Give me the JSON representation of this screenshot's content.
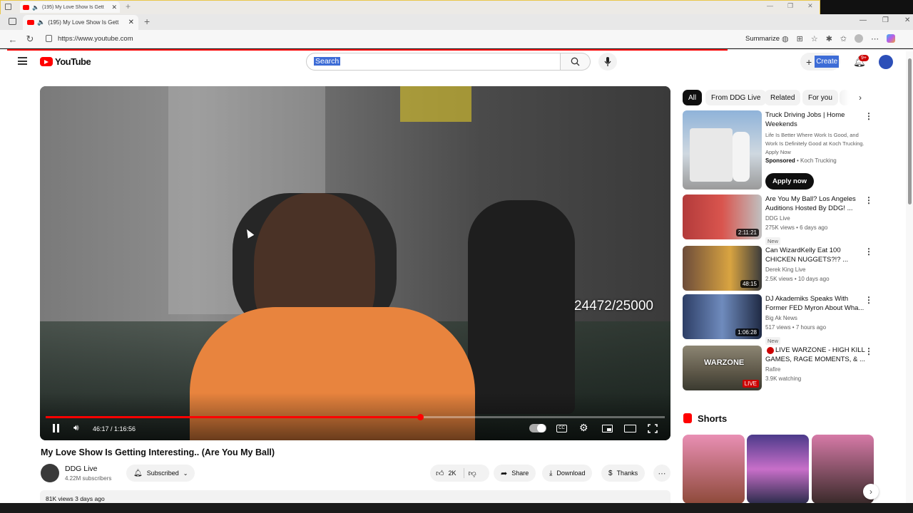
{
  "outer_tab": {
    "title": "(195) My Love Show Is Gett"
  },
  "browser": {
    "tab_title": "(195) My Love Show Is Gett",
    "url": "https://www.youtube.com",
    "summarize": "Summarize"
  },
  "header": {
    "logo_text": "YouTube",
    "search_value": "Search",
    "create_label": "Create",
    "notif_count": "9+"
  },
  "player": {
    "overlay_counter": "24472/25000",
    "time": "46:17 / 1:16:56",
    "progress": 0.605
  },
  "video": {
    "title": "My Love Show Is Getting Interesting.. (Are You My Ball)",
    "channel": "DDG Live",
    "subscribers": "4.22M subscribers",
    "subscribed_label": "Subscribed",
    "likes": "2K",
    "share": "Share",
    "download": "Download",
    "thanks": "Thanks",
    "views_date": "81K views  3 days ago"
  },
  "chips": [
    "All",
    "From DDG Live",
    "Related",
    "For you"
  ],
  "ad": {
    "title": "Truck Driving Jobs | Home Weekends",
    "desc": "Life Is Better Where Work Is Good, and Work Is Definitely Good at Koch Trucking. Apply Now",
    "sponsor_label": "Sponsored",
    "sponsor": "Koch Trucking",
    "cta": "Apply now"
  },
  "recs": [
    {
      "title": "Are You My Ball? Los Angeles Auditions Hosted By DDG! ...",
      "channel": "DDG Live",
      "meta": "275K views • 6 days ago",
      "badge": "New",
      "duration": "2:11:21"
    },
    {
      "title": "Can WizardKelly Eat 100 CHICKEN NUGGETS?!? ...",
      "channel": "Derek King Live",
      "meta": "2.5K views • 10 days ago",
      "badge": "",
      "duration": "48:15"
    },
    {
      "title": "DJ Akademiks Speaks With Former FED Myron About Wha...",
      "channel": "Big Ak News",
      "meta": "517 views • 7 hours ago",
      "badge": "New",
      "duration": "1:06:28"
    },
    {
      "title": "LIVE WARZONE - HIGH KILL GAMES, RAGE MOMENTS, & ...",
      "channel": "Rafire",
      "meta": "3.9K watching",
      "badge": "",
      "duration": "LIVE"
    }
  ],
  "shorts": {
    "title": "Shorts"
  },
  "colors": {
    "yt_red": "#ff0000",
    "accent_blue": "#3d6cd6"
  }
}
